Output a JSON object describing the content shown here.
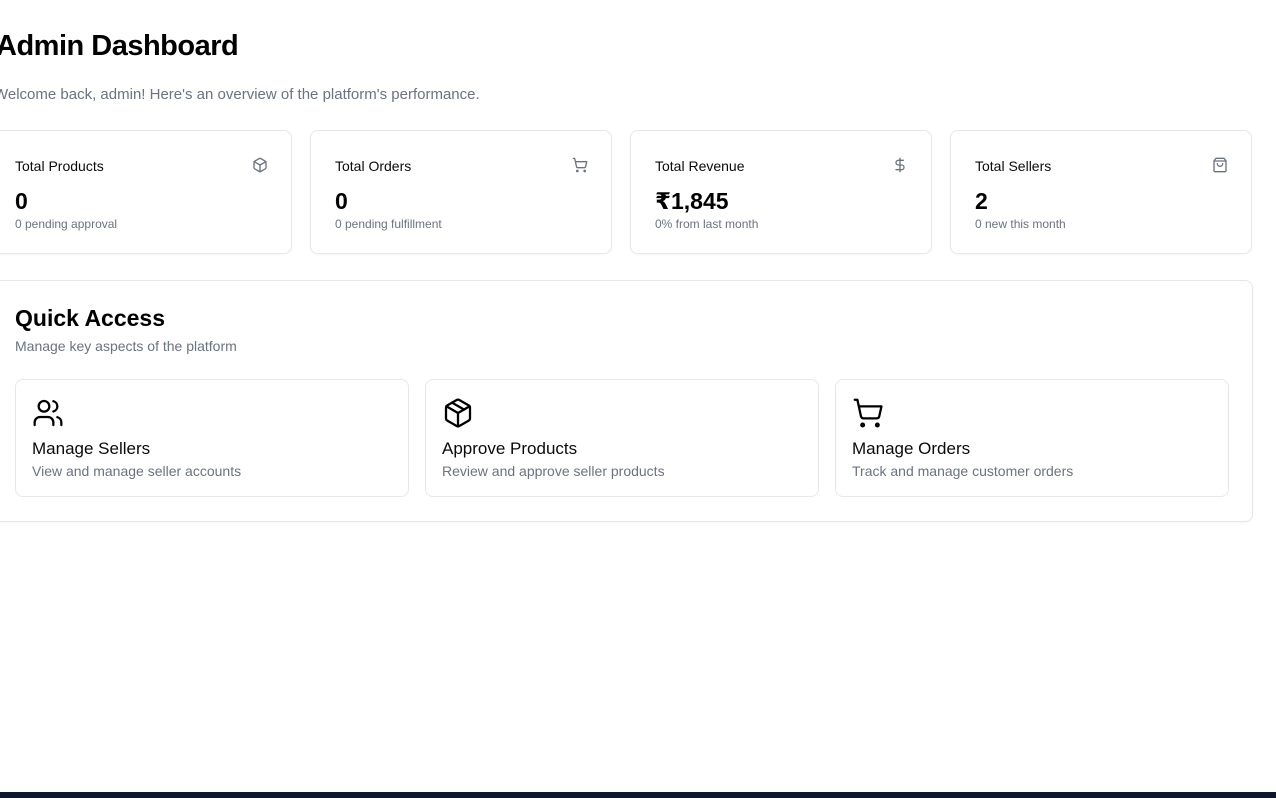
{
  "header": {
    "title": "Admin Dashboard",
    "subtitle": "Welcome back, admin! Here's an overview of the platform's performance."
  },
  "stats": [
    {
      "label": "Total Products",
      "value": "0",
      "sub": "0 pending approval",
      "icon": "package-icon"
    },
    {
      "label": "Total Orders",
      "value": "0",
      "sub": "0 pending fulfillment",
      "icon": "cart-icon"
    },
    {
      "label": "Total Revenue",
      "value": "₹1,845",
      "sub": "0% from last month",
      "icon": "dollar-icon"
    },
    {
      "label": "Total Sellers",
      "value": "2",
      "sub": "0 new this month",
      "icon": "shopping-bag-icon"
    }
  ],
  "quick_access": {
    "title": "Quick Access",
    "subtitle": "Manage key aspects of the platform",
    "items": [
      {
        "title": "Manage Sellers",
        "desc": "View and manage seller accounts",
        "icon": "users-icon"
      },
      {
        "title": "Approve Products",
        "desc": "Review and approve seller products",
        "icon": "package-icon"
      },
      {
        "title": "Manage Orders",
        "desc": "Track and manage customer orders",
        "icon": "cart-icon"
      }
    ]
  },
  "colors": {
    "text": "#0a0a0a",
    "muted": "#6b7280",
    "border": "#e5e7eb",
    "footer_bar": "#0f172a"
  }
}
